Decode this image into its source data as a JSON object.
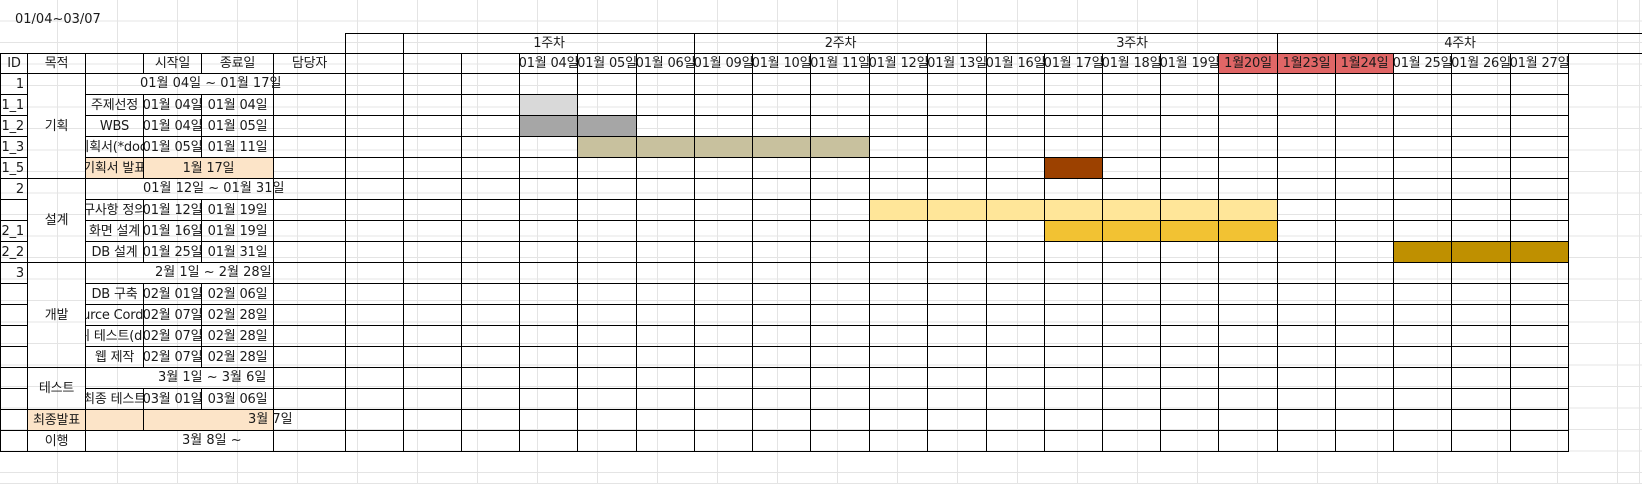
{
  "sheet": {
    "range_label": "01/04~03/07"
  },
  "headers": {
    "id": "ID",
    "purpose": "목적",
    "start": "시작일",
    "end": "종료일",
    "owner": "담당자"
  },
  "weeks": [
    "1주차",
    "2주차",
    "3주차",
    "4주차"
  ],
  "dates": [
    "01월 04일",
    "01월 05일",
    "01월 06일",
    "01월 09일",
    "01월 10일",
    "01월 11일",
    "01월 12일",
    "01월 13일",
    "01월 16일",
    "01월 17일",
    "01월 18일",
    "01월 19일",
    "1월20일",
    "1월23일",
    "1월24일",
    "01월 25일",
    "01월 26일",
    "01월 27일"
  ],
  "holiday_date_color": "#e06666",
  "groups": [
    {
      "key": "plan",
      "name": "기획",
      "range": "01월 04일 ~  01월 17일"
    },
    {
      "key": "design",
      "name": "설계",
      "range": "01월 12일 ~ 01월 31일"
    },
    {
      "key": "dev",
      "name": "개발",
      "range": "2월 1일 ~ 2월 28일"
    },
    {
      "key": "test",
      "name": "테스트",
      "range": "3월 1일 ~ 3월 6일"
    },
    {
      "key": "final",
      "name": "최종발표",
      "range": "3월 7일"
    },
    {
      "key": "migrate",
      "name": "이행",
      "range": "3월 8일 ~"
    }
  ],
  "ids": [
    "1",
    "1_1",
    "1_2",
    "1_3",
    "1_5",
    "2",
    "",
    "2_1",
    "2_2",
    "3"
  ],
  "tasks": [
    {
      "name": "주제선정",
      "start": "01월 04일",
      "end": "01월 04일"
    },
    {
      "name": "WBS",
      "start": "01월 04일",
      "end": "01월 05일"
    },
    {
      "name": "기획서(*doc)",
      "start": "01월 05일",
      "end": "01월 11일"
    },
    {
      "name": "기획서 발표",
      "date": "1월 17일"
    },
    {
      "name": "요구사항 정의서",
      "start": "01월 12일",
      "end": "01월 19일"
    },
    {
      "name": "화면 설계",
      "start": "01월 16일",
      "end": "01월 19일"
    },
    {
      "name": "DB 설계",
      "start": "01월 25일",
      "end": "01월 31일"
    },
    {
      "name": "DB 구축",
      "start": "02월 01일",
      "end": "02월 06일"
    },
    {
      "name": "Source Cording",
      "start": "02월 07일",
      "end": "02월 28일"
    },
    {
      "name": "단위 테스트(dao)",
      "start": "02월 07일",
      "end": "02월 28일"
    },
    {
      "name": "웹 제작",
      "start": "02월 07일",
      "end": "02월 28일"
    },
    {
      "name": "최종 테스트",
      "start": "03월 01일",
      "end": "03월 06일"
    }
  ],
  "colors": {
    "milestone_fill": "#fce4c8",
    "bar_topic": "#d9d9d9",
    "bar_wbs": "#a6a6a6",
    "bar_doc": "#c8c19e",
    "bar_present": "#9c4100",
    "bar_req": "#ffe699",
    "bar_screen": "#f2c233",
    "bar_db": "#bf9000"
  }
}
